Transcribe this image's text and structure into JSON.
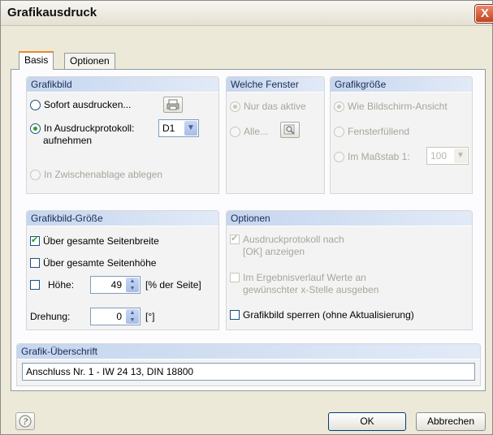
{
  "window": {
    "title": "Grafikausdruck",
    "close_label": "X"
  },
  "tabs": [
    {
      "label": "Basis"
    },
    {
      "label": "Optionen"
    }
  ],
  "grafikbild": {
    "header": "Grafikbild",
    "sofort": "Sofort ausdrucken...",
    "protokoll_line1": "In Ausdruckprotokoll:",
    "protokoll_line2": "aufnehmen",
    "protokoll_select": "D1",
    "zwischenablage": "In Zwischenablage ablegen"
  },
  "fenster": {
    "header": "Welche Fenster",
    "nur_aktive": "Nur das aktive",
    "alle": "Alle..."
  },
  "groesse": {
    "header": "Grafikgröße",
    "bildschirm": "Wie Bildschirm-Ansicht",
    "fensterfuellend": "Fensterfüllend",
    "massstab": "Im Maßstab 1:",
    "massstab_value": "100"
  },
  "bildgroesse": {
    "header": "Grafikbild-Größe",
    "seitenbreite": "Über gesamte Seitenbreite",
    "seitenhoehe": "Über gesamte Seitenhöhe",
    "hoehe_label": "Höhe:",
    "hoehe_value": "49",
    "hoehe_unit": "[% der Seite]",
    "drehung_label": "Drehung:",
    "drehung_value": "0",
    "drehung_unit": "[°]"
  },
  "optionen": {
    "header": "Optionen",
    "ausdruck_line1": "Ausdruckprotokoll nach",
    "ausdruck_line2": "[OK] anzeigen",
    "ergebnis_line1": "Im Ergebnisverlauf Werte an",
    "ergebnis_line2": "gewünschter x-Stelle ausgeben",
    "sperren": "Grafikbild sperren (ohne Aktualisierung)"
  },
  "ueberschrift": {
    "header": "Grafik-Überschrift",
    "value": "Anschluss Nr. 1 - IW 24 13, DIN 18800"
  },
  "buttons": {
    "ok": "OK",
    "cancel": "Abbrechen"
  }
}
